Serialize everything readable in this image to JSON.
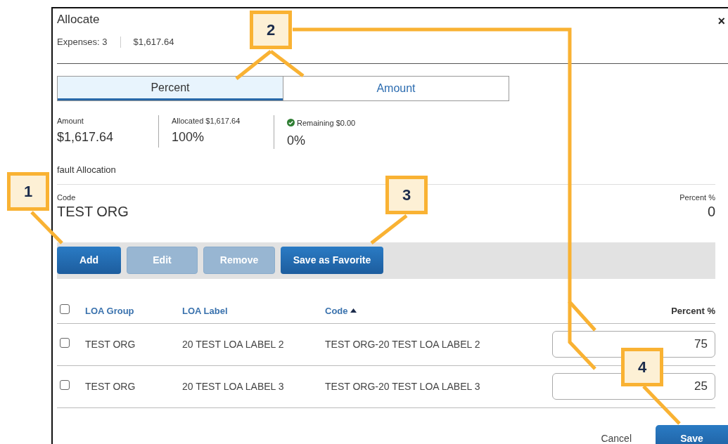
{
  "dialog": {
    "title": "Allocate",
    "close": "×",
    "expenses": "Expenses: 3",
    "total": "$1,617.64"
  },
  "tabs": [
    {
      "label": "Percent",
      "selected": true
    },
    {
      "label": "Amount",
      "selected": false
    }
  ],
  "summary": [
    {
      "label": "Amount",
      "value": "$1,617.64",
      "kind": "plain"
    },
    {
      "label": "Allocated $1,617.64",
      "value": "100%",
      "kind": "plain"
    },
    {
      "label": "Remaining $0.00",
      "value": "0%",
      "kind": "ok"
    }
  ],
  "default_allocation": {
    "heading": "fault Allocation",
    "code_label": "Code",
    "code": "TEST ORG",
    "percent_label": "Percent %",
    "percent": "0"
  },
  "toolbar": [
    {
      "label": "Add",
      "disabled": false
    },
    {
      "label": "Edit",
      "disabled": true
    },
    {
      "label": "Remove",
      "disabled": true
    },
    {
      "label": "Save as Favorite",
      "disabled": false
    }
  ],
  "table": {
    "header_checked": false,
    "columns": [
      {
        "label": "LOA Group",
        "sorted": false
      },
      {
        "label": "LOA Label",
        "sorted": false
      },
      {
        "label": "Code",
        "sorted": true
      },
      {
        "label": "Percent %",
        "sorted": false
      }
    ],
    "rows": [
      {
        "checked": false,
        "loa_group": "TEST ORG",
        "loa_label": "20 TEST LOA LABEL 2",
        "code": "TEST ORG-20 TEST LOA LABEL 2",
        "percent": "75"
      },
      {
        "checked": false,
        "loa_group": "TEST ORG",
        "loa_label": "20 TEST LOA LABEL 3",
        "code": "TEST ORG-20 TEST LOA LABEL 3",
        "percent": "25"
      }
    ]
  },
  "footer": {
    "cancel": "Cancel",
    "save": "Save"
  },
  "callouts": [
    {
      "number": "1"
    },
    {
      "number": "2"
    },
    {
      "number": "3"
    },
    {
      "number": "4"
    }
  ]
}
